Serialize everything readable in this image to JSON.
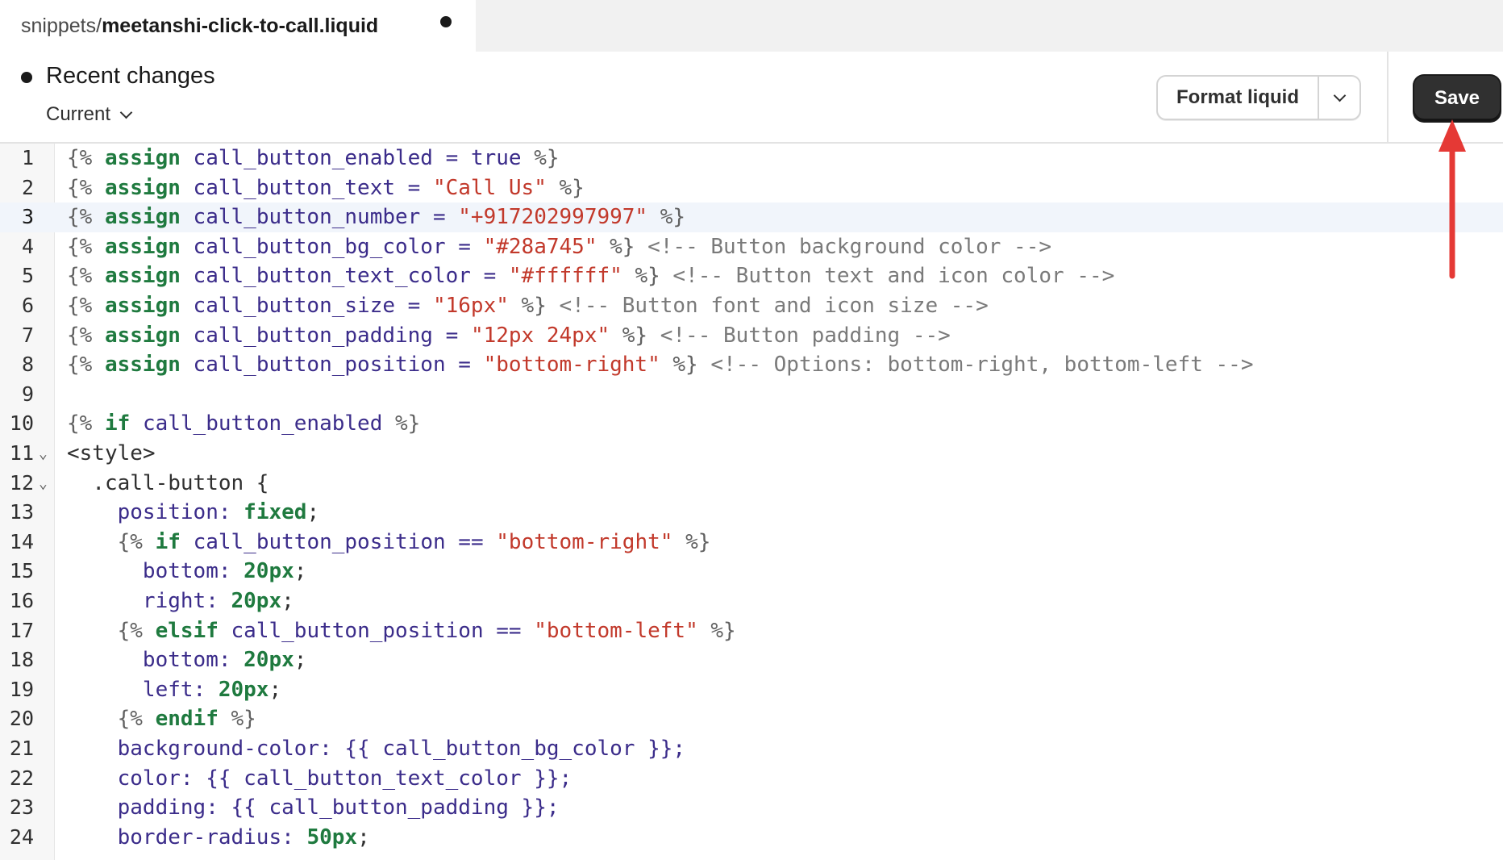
{
  "tab": {
    "dir": "snippets/",
    "file": "meetanshi-click-to-call.liquid"
  },
  "header": {
    "title": "Recent changes",
    "version": "Current",
    "format_label": "Format liquid",
    "save_label": "Save"
  },
  "editor": {
    "active_line": 3,
    "lines": [
      {
        "n": "1",
        "fold": "",
        "tokens": [
          [
            "b",
            "{%"
          ],
          [
            "s",
            " "
          ],
          [
            "k",
            "assign"
          ],
          [
            "s",
            " "
          ],
          [
            "v",
            "call_button_enabled"
          ],
          [
            "s",
            " "
          ],
          [
            "o",
            "="
          ],
          [
            "s",
            " "
          ],
          [
            "v",
            "true"
          ],
          [
            "s",
            " "
          ],
          [
            "b",
            "%}"
          ]
        ]
      },
      {
        "n": "2",
        "fold": "",
        "tokens": [
          [
            "b",
            "{%"
          ],
          [
            "s",
            " "
          ],
          [
            "k",
            "assign"
          ],
          [
            "s",
            " "
          ],
          [
            "v",
            "call_button_text"
          ],
          [
            "s",
            " "
          ],
          [
            "o",
            "="
          ],
          [
            "s",
            " "
          ],
          [
            "q",
            "\"Call Us\""
          ],
          [
            "s",
            " "
          ],
          [
            "b",
            "%}"
          ]
        ]
      },
      {
        "n": "3",
        "fold": "",
        "tokens": [
          [
            "b",
            "{%"
          ],
          [
            "s",
            " "
          ],
          [
            "k",
            "assign"
          ],
          [
            "s",
            " "
          ],
          [
            "v",
            "call_button_number"
          ],
          [
            "s",
            " "
          ],
          [
            "o",
            "="
          ],
          [
            "s",
            " "
          ],
          [
            "q",
            "\"+917202997997\""
          ],
          [
            "s",
            " "
          ],
          [
            "b",
            "%}"
          ]
        ]
      },
      {
        "n": "4",
        "fold": "",
        "tokens": [
          [
            "b",
            "{%"
          ],
          [
            "s",
            " "
          ],
          [
            "k",
            "assign"
          ],
          [
            "s",
            " "
          ],
          [
            "v",
            "call_button_bg_color"
          ],
          [
            "s",
            " "
          ],
          [
            "o",
            "="
          ],
          [
            "s",
            " "
          ],
          [
            "q",
            "\"#28a745\""
          ],
          [
            "s",
            " "
          ],
          [
            "b",
            "%}"
          ],
          [
            "s",
            " "
          ],
          [
            "c",
            "<!-- Button background color -->"
          ]
        ]
      },
      {
        "n": "5",
        "fold": "",
        "tokens": [
          [
            "b",
            "{%"
          ],
          [
            "s",
            " "
          ],
          [
            "k",
            "assign"
          ],
          [
            "s",
            " "
          ],
          [
            "v",
            "call_button_text_color"
          ],
          [
            "s",
            " "
          ],
          [
            "o",
            "="
          ],
          [
            "s",
            " "
          ],
          [
            "q",
            "\"#ffffff\""
          ],
          [
            "s",
            " "
          ],
          [
            "b",
            "%}"
          ],
          [
            "s",
            " "
          ],
          [
            "c",
            "<!-- Button text and icon color -->"
          ]
        ]
      },
      {
        "n": "6",
        "fold": "",
        "tokens": [
          [
            "b",
            "{%"
          ],
          [
            "s",
            " "
          ],
          [
            "k",
            "assign"
          ],
          [
            "s",
            " "
          ],
          [
            "v",
            "call_button_size"
          ],
          [
            "s",
            " "
          ],
          [
            "o",
            "="
          ],
          [
            "s",
            " "
          ],
          [
            "q",
            "\"16px\""
          ],
          [
            "s",
            " "
          ],
          [
            "b",
            "%}"
          ],
          [
            "s",
            " "
          ],
          [
            "c",
            "<!-- Button font and icon size -->"
          ]
        ]
      },
      {
        "n": "7",
        "fold": "",
        "tokens": [
          [
            "b",
            "{%"
          ],
          [
            "s",
            " "
          ],
          [
            "k",
            "assign"
          ],
          [
            "s",
            " "
          ],
          [
            "v",
            "call_button_padding"
          ],
          [
            "s",
            " "
          ],
          [
            "o",
            "="
          ],
          [
            "s",
            " "
          ],
          [
            "q",
            "\"12px 24px\""
          ],
          [
            "s",
            " "
          ],
          [
            "b",
            "%}"
          ],
          [
            "s",
            " "
          ],
          [
            "c",
            "<!-- Button padding -->"
          ]
        ]
      },
      {
        "n": "8",
        "fold": "",
        "tokens": [
          [
            "b",
            "{%"
          ],
          [
            "s",
            " "
          ],
          [
            "k",
            "assign"
          ],
          [
            "s",
            " "
          ],
          [
            "v",
            "call_button_position"
          ],
          [
            "s",
            " "
          ],
          [
            "o",
            "="
          ],
          [
            "s",
            " "
          ],
          [
            "q",
            "\"bottom-right\""
          ],
          [
            "s",
            " "
          ],
          [
            "b",
            "%}"
          ],
          [
            "s",
            " "
          ],
          [
            "c",
            "<!-- Options: bottom-right, bottom-left -->"
          ]
        ]
      },
      {
        "n": "9",
        "fold": "",
        "tokens": []
      },
      {
        "n": "10",
        "fold": "",
        "tokens": [
          [
            "b",
            "{%"
          ],
          [
            "s",
            " "
          ],
          [
            "k",
            "if"
          ],
          [
            "s",
            " "
          ],
          [
            "v",
            "call_button_enabled"
          ],
          [
            "s",
            " "
          ],
          [
            "b",
            "%}"
          ]
        ]
      },
      {
        "n": "11",
        "fold": "⌄",
        "tokens": [
          [
            "t",
            "<style>"
          ]
        ]
      },
      {
        "n": "12",
        "fold": "⌄",
        "tokens": [
          [
            "s",
            "  "
          ],
          [
            "t",
            ".call-button {"
          ]
        ]
      },
      {
        "n": "13",
        "fold": "",
        "tokens": [
          [
            "s",
            "    "
          ],
          [
            "p",
            "position: "
          ],
          [
            "n",
            "fixed"
          ],
          [
            "t",
            ";"
          ]
        ]
      },
      {
        "n": "14",
        "fold": "",
        "tokens": [
          [
            "s",
            "    "
          ],
          [
            "b",
            "{%"
          ],
          [
            "s",
            " "
          ],
          [
            "k",
            "if"
          ],
          [
            "s",
            " "
          ],
          [
            "v",
            "call_button_position"
          ],
          [
            "s",
            " "
          ],
          [
            "o",
            "=="
          ],
          [
            "s",
            " "
          ],
          [
            "q",
            "\"bottom-right\""
          ],
          [
            "s",
            " "
          ],
          [
            "b",
            "%}"
          ]
        ]
      },
      {
        "n": "15",
        "fold": "",
        "tokens": [
          [
            "s",
            "      "
          ],
          [
            "p",
            "bottom: "
          ],
          [
            "n",
            "20px"
          ],
          [
            "t",
            ";"
          ]
        ]
      },
      {
        "n": "16",
        "fold": "",
        "tokens": [
          [
            "s",
            "      "
          ],
          [
            "p",
            "right: "
          ],
          [
            "n",
            "20px"
          ],
          [
            "t",
            ";"
          ]
        ]
      },
      {
        "n": "17",
        "fold": "",
        "tokens": [
          [
            "s",
            "    "
          ],
          [
            "b",
            "{%"
          ],
          [
            "s",
            " "
          ],
          [
            "k",
            "elsif"
          ],
          [
            "s",
            " "
          ],
          [
            "v",
            "call_button_position"
          ],
          [
            "s",
            " "
          ],
          [
            "o",
            "=="
          ],
          [
            "s",
            " "
          ],
          [
            "q",
            "\"bottom-left\""
          ],
          [
            "s",
            " "
          ],
          [
            "b",
            "%}"
          ]
        ]
      },
      {
        "n": "18",
        "fold": "",
        "tokens": [
          [
            "s",
            "      "
          ],
          [
            "p",
            "bottom: "
          ],
          [
            "n",
            "20px"
          ],
          [
            "t",
            ";"
          ]
        ]
      },
      {
        "n": "19",
        "fold": "",
        "tokens": [
          [
            "s",
            "      "
          ],
          [
            "p",
            "left: "
          ],
          [
            "n",
            "20px"
          ],
          [
            "t",
            ";"
          ]
        ]
      },
      {
        "n": "20",
        "fold": "",
        "tokens": [
          [
            "s",
            "    "
          ],
          [
            "b",
            "{%"
          ],
          [
            "s",
            " "
          ],
          [
            "k",
            "endif"
          ],
          [
            "s",
            " "
          ],
          [
            "b",
            "%}"
          ]
        ]
      },
      {
        "n": "21",
        "fold": "",
        "tokens": [
          [
            "s",
            "    "
          ],
          [
            "p",
            "background-color: {{ "
          ],
          [
            "v",
            "call_button_bg_color"
          ],
          [
            "p",
            " }};"
          ]
        ]
      },
      {
        "n": "22",
        "fold": "",
        "tokens": [
          [
            "s",
            "    "
          ],
          [
            "p",
            "color: {{ "
          ],
          [
            "v",
            "call_button_text_color"
          ],
          [
            "p",
            " }};"
          ]
        ]
      },
      {
        "n": "23",
        "fold": "",
        "tokens": [
          [
            "s",
            "    "
          ],
          [
            "p",
            "padding: {{ "
          ],
          [
            "v",
            "call_button_padding"
          ],
          [
            "p",
            " }};"
          ]
        ]
      },
      {
        "n": "24",
        "fold": "",
        "tokens": [
          [
            "s",
            "    "
          ],
          [
            "p",
            "border-radius: "
          ],
          [
            "n",
            "50px"
          ],
          [
            "t",
            ";"
          ]
        ]
      }
    ]
  },
  "annotation": {
    "arrow_color": "#e53935"
  },
  "colors": {
    "save_bg": "#303030",
    "keyword": "#1f7a3f",
    "string": "#c2392b",
    "variable": "#3b2c8a",
    "comment": "#7a7a7a"
  }
}
